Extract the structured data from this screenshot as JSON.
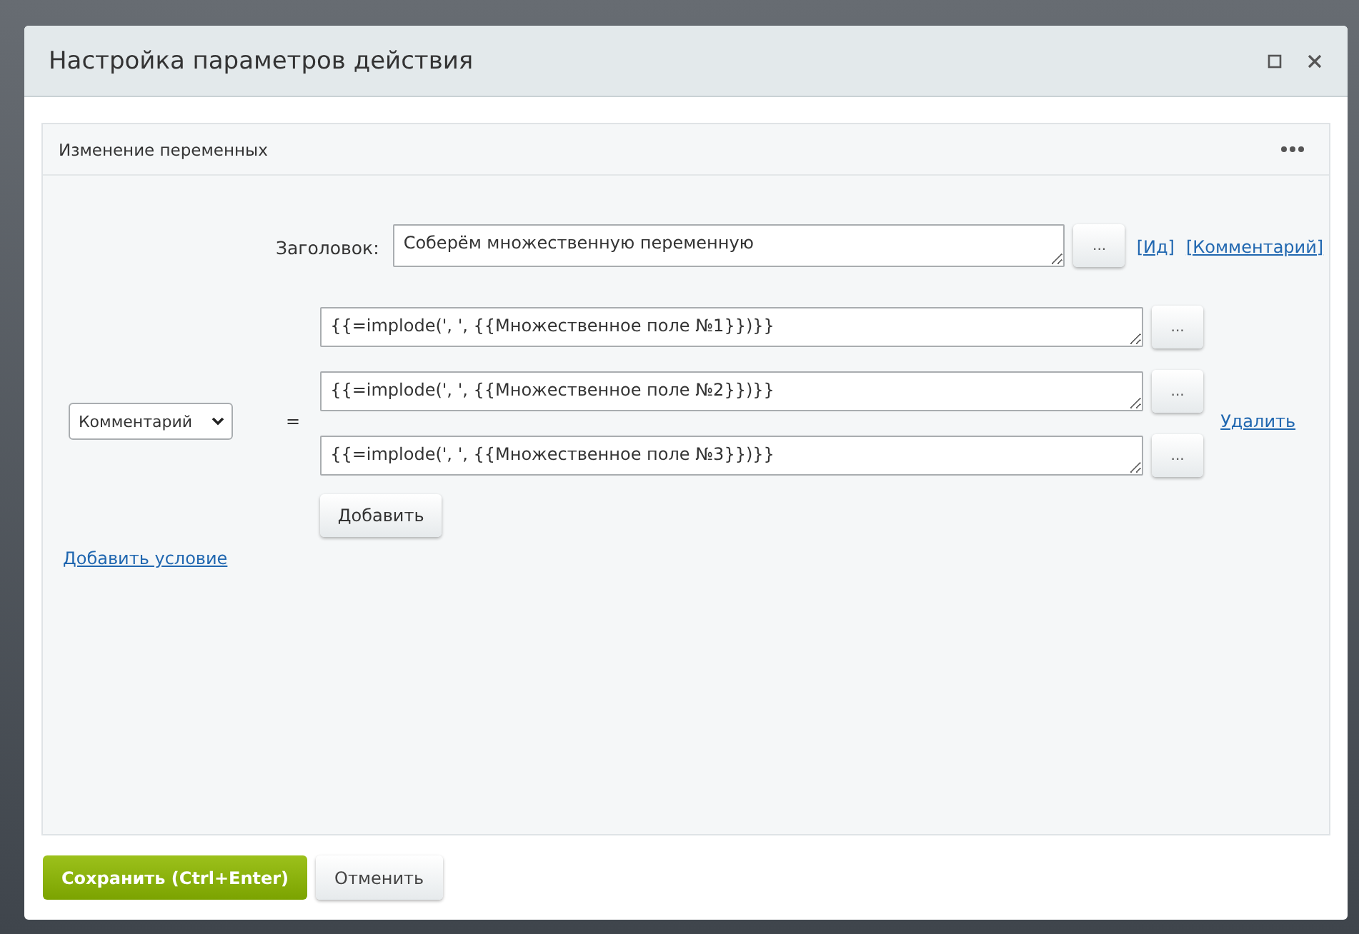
{
  "dialog": {
    "title": "Настройка параметров действия"
  },
  "panel": {
    "title": "Изменение переменных"
  },
  "title_field": {
    "label": "Заголовок:",
    "value": "Соберём множественную переменную",
    "picker": "...",
    "links": [
      "[Ид]",
      "[Комментарий]"
    ]
  },
  "assignment": {
    "variable": "Комментарий",
    "operator": "=",
    "values": [
      {
        "value": "{{=implode(', ', {{Множественное поле №1}})}}",
        "picker": "..."
      },
      {
        "value": "{{=implode(', ', {{Множественное поле №2}})}}",
        "picker": "..."
      },
      {
        "value": "{{=implode(', ', {{Множественное поле №3}})}}",
        "picker": "..."
      }
    ],
    "add_button": "Добавить",
    "delete_link": "Удалить"
  },
  "add_condition": "Добавить условие",
  "buttons": [
    {
      "label": "Сохранить (Ctrl+Enter)",
      "kind": "primary"
    },
    {
      "label": "Отменить",
      "kind": "secondary"
    }
  ]
}
